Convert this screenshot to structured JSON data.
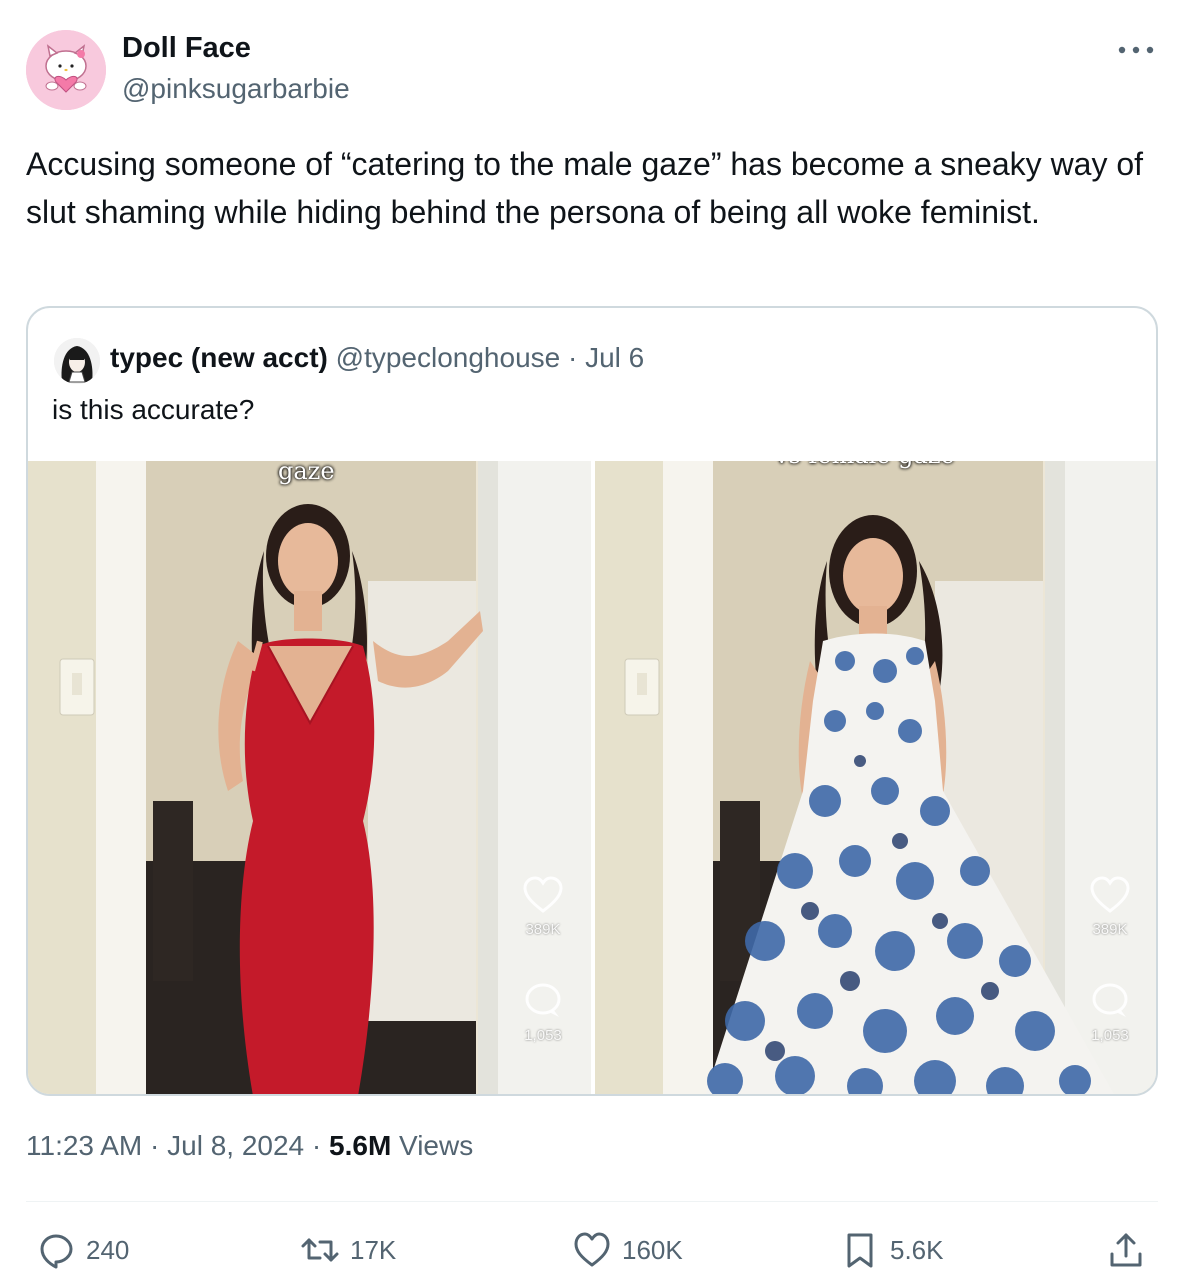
{
  "author": {
    "display_name": "Doll Face",
    "handle": "@pinksugarbarbie",
    "avatar_icon": "hello-kitty-avatar"
  },
  "tweet": {
    "text": "Accusing someone of “catering to the male gaze” has become a sneaky way of slut shaming while hiding behind the persona of being all woke feminist."
  },
  "quote": {
    "display_name": "typec (new acct)",
    "handle": "@typeclonghouse",
    "separator": " · ",
    "date": "Jul 6",
    "text": "is this accurate?",
    "media": [
      {
        "caption": "gaze",
        "likes": "389K",
        "comments": "1,053",
        "dress_color": "#c41a2a"
      },
      {
        "caption": "vs female gaze",
        "likes": "389K",
        "comments": "1,053",
        "dress_color": "#3f69a8"
      }
    ]
  },
  "meta": {
    "time": "11:23 AM",
    "dot": " · ",
    "date": "Jul 8, 2024",
    "views_count": "5.6M",
    "views_label": " Views"
  },
  "actions": {
    "replies": "240",
    "reposts": "17K",
    "likes": "160K",
    "bookmarks": "5.6K"
  },
  "colors": {
    "text": "#0f1419",
    "secondary": "#536471",
    "border": "#cfd9de"
  }
}
